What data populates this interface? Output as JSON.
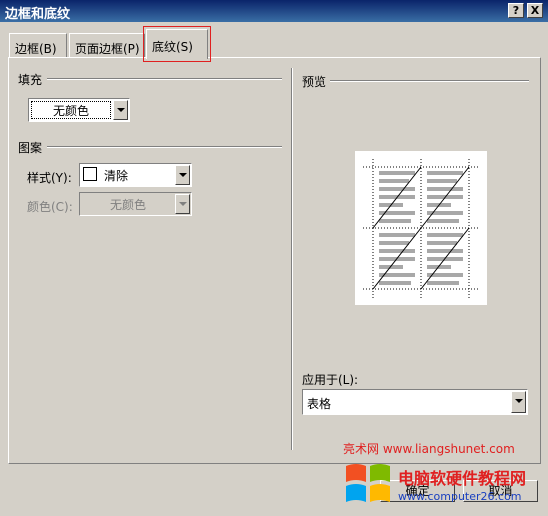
{
  "window": {
    "title": "边框和底纹",
    "help_label": "?",
    "close_label": "X"
  },
  "tabs": [
    {
      "label": "边框(B)"
    },
    {
      "label": "页面边框(P)"
    },
    {
      "label": "底纹(S)"
    }
  ],
  "fill": {
    "group_label": "填充",
    "color_value": "无颜色"
  },
  "pattern": {
    "group_label": "图案",
    "style_label": "样式(Y):",
    "style_value": "清除",
    "color_label": "颜色(C):",
    "color_value": "无颜色"
  },
  "preview": {
    "group_label": "预览",
    "apply_label": "应用于(L):",
    "apply_value": "表格"
  },
  "buttons": {
    "ok_label": "确定",
    "cancel_label": "取消"
  },
  "watermark": {
    "line1": "亮术网 www.liangshunet.com",
    "brand": "电脑软硬件教程网",
    "url": "www.computer26.com"
  }
}
